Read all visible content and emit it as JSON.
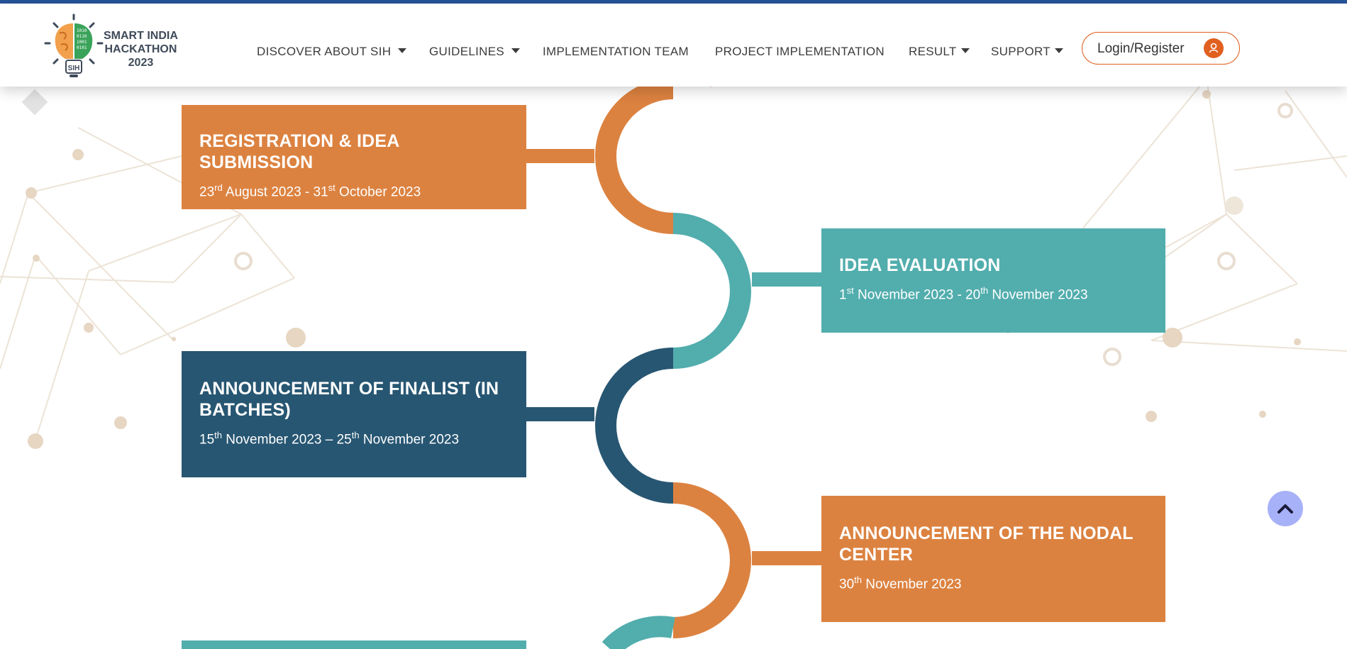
{
  "brand": {
    "line1": "SMART INDIA",
    "line2": "HACKATHON",
    "year": "2023",
    "badge": "SIH"
  },
  "nav": {
    "items": [
      {
        "label": "DISCOVER ABOUT SIH",
        "has_dropdown": true
      },
      {
        "label": "GUIDELINES",
        "has_dropdown": true
      },
      {
        "label": "IMPLEMENTATION TEAM",
        "has_dropdown": false
      },
      {
        "label": "PROJECT IMPLEMENTATION",
        "has_dropdown": false
      },
      {
        "label": "RESULT",
        "has_dropdown": true
      },
      {
        "label": "SUPPORT",
        "has_dropdown": true
      }
    ],
    "login_label": "Login/Register"
  },
  "colors": {
    "orange": "#dc8240",
    "teal": "#52adad",
    "navy": "#275672",
    "accent_red": "#d14f5a",
    "brand_blue": "#26549a",
    "login_orange": "#e0601f"
  },
  "timeline": [
    {
      "title": "REGISTRATION & IDEA SUBMISSION",
      "date_parts": [
        "23",
        "rd",
        " August 2023 - 31",
        "st",
        " October 2023"
      ],
      "color": "#dc8240"
    },
    {
      "title": "IDEA EVALUATION",
      "date_parts": [
        "1",
        "st",
        " November 2023 - 20",
        "th",
        " November 2023"
      ],
      "color": "#52adad"
    },
    {
      "title": "ANNOUNCEMENT OF FINALIST (IN BATCHES)",
      "date_parts": [
        "15",
        "th",
        " November 2023 – 25",
        "th",
        " November 2023"
      ],
      "color": "#275672"
    },
    {
      "title": "ANNOUNCEMENT OF THE NODAL CENTER",
      "date_parts": [
        "30",
        "th",
        " November 2023"
      ],
      "color": "#dc8240"
    }
  ],
  "icons": {
    "scroll_top": "chevron-up-icon",
    "user": "user-icon"
  }
}
